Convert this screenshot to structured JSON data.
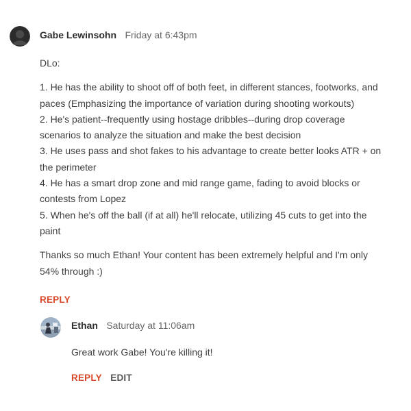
{
  "comment": {
    "avatar_icon": "user-silhouette-icon",
    "author": "Gabe Lewinsohn",
    "timestamp": "Friday at 6:43pm",
    "body": {
      "intro": "DLo:",
      "points": "1. He has the ability to shoot off of both feet, in different stances, footworks, and paces (Emphasizing the importance of variation during shooting workouts)\n2. He's patient--frequently using hostage dribbles--during drop coverage scenarios to analyze the situation and make the best decision\n3. He uses pass and shot fakes to his advantage to create better looks ATR + on the perimeter\n4. He has a smart drop zone and mid range game, fading to avoid blocks or contests from Lopez\n5. When he's off the ball (if at all) he'll relocate, utilizing 45 cuts to get into the paint",
      "closing": "Thanks so much Ethan! Your content has been extremely helpful and I'm only 54% through :)"
    },
    "reply_label": "REPLY"
  },
  "reply": {
    "avatar_icon": "photo-avatar-icon",
    "author": "Ethan",
    "timestamp": "Saturday at 11:06am",
    "body": "Great work Gabe! You're killing it!",
    "reply_label": "REPLY",
    "edit_label": "EDIT"
  },
  "colors": {
    "accent": "#d9482b",
    "text": "#3e3e3e",
    "muted": "#666666",
    "avatar_dark": "#2b2b2b"
  }
}
